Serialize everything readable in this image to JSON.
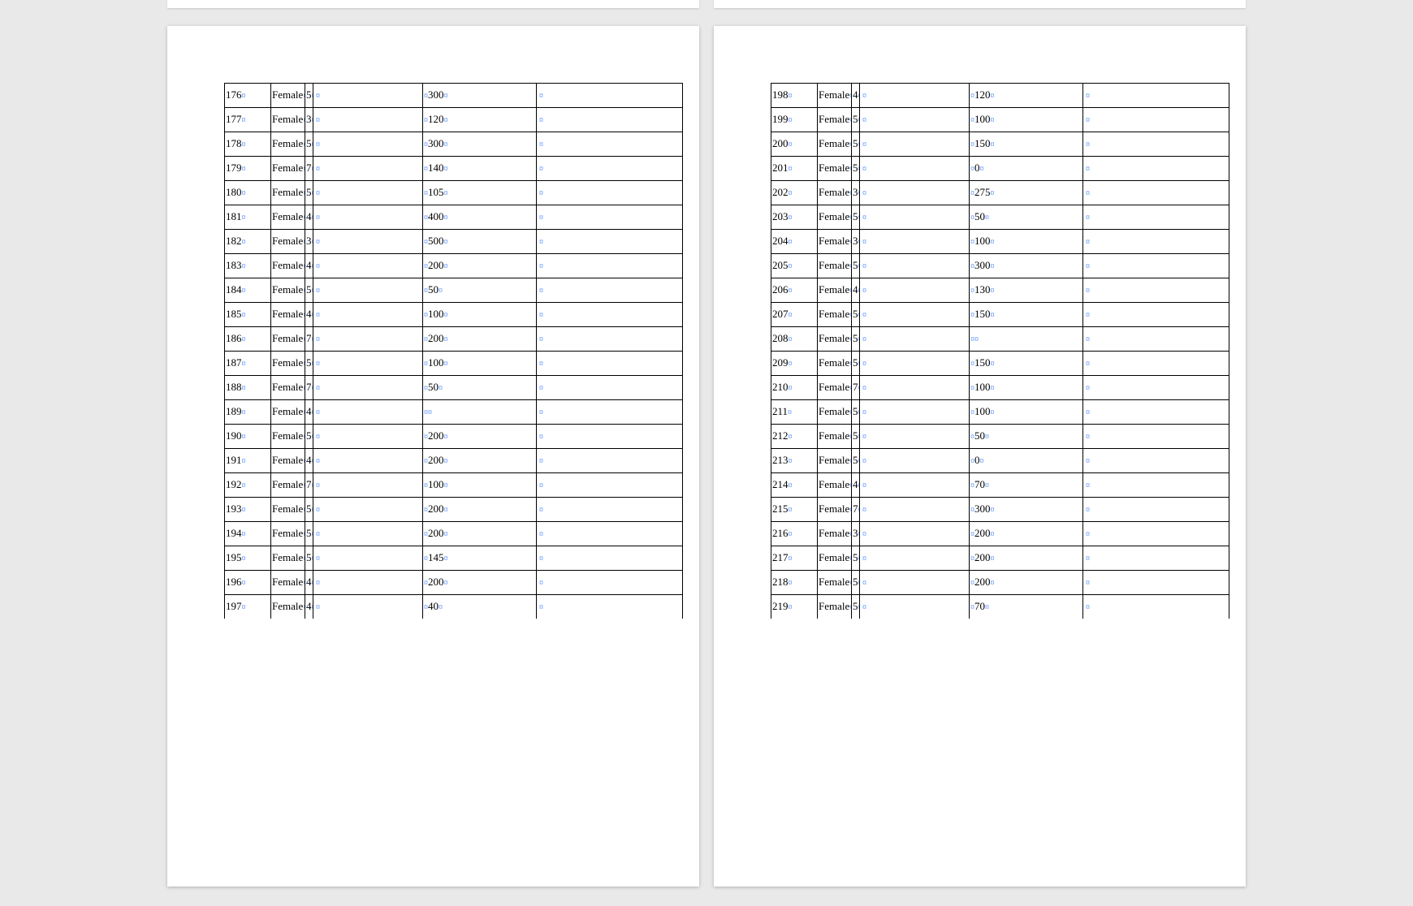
{
  "formatting_mark": "¤",
  "pages": [
    {
      "rows": [
        {
          "id": "176",
          "gender": "Female",
          "num": "5",
          "value": "300"
        },
        {
          "id": "177",
          "gender": "Female",
          "num": "3",
          "value": "120"
        },
        {
          "id": "178",
          "gender": "Female",
          "num": "5",
          "value": "300"
        },
        {
          "id": "179",
          "gender": "Female",
          "num": "7",
          "value": "140"
        },
        {
          "id": "180",
          "gender": "Female",
          "num": "5",
          "value": "105"
        },
        {
          "id": "181",
          "gender": "Female",
          "num": "4",
          "value": "400"
        },
        {
          "id": "182",
          "gender": "Female",
          "num": "3",
          "value": "500"
        },
        {
          "id": "183",
          "gender": "Female",
          "num": "4",
          "value": "200"
        },
        {
          "id": "184",
          "gender": "Female",
          "num": "5",
          "value": "50"
        },
        {
          "id": "185",
          "gender": "Female",
          "num": "4",
          "value": "100"
        },
        {
          "id": "186",
          "gender": "Female",
          "num": "7",
          "value": "200"
        },
        {
          "id": "187",
          "gender": "Female",
          "num": "5",
          "value": "100"
        },
        {
          "id": "188",
          "gender": "Female",
          "num": "7",
          "value": "50"
        },
        {
          "id": "189",
          "gender": "Female",
          "num": "4",
          "value": ""
        },
        {
          "id": "190",
          "gender": "Female",
          "num": "5",
          "value": "200"
        },
        {
          "id": "191",
          "gender": "Female",
          "num": "4",
          "value": "200"
        },
        {
          "id": "192",
          "gender": "Female",
          "num": "7",
          "value": "100"
        },
        {
          "id": "193",
          "gender": "Female",
          "num": "5",
          "value": "200"
        },
        {
          "id": "194",
          "gender": "Female",
          "num": "5",
          "value": "200"
        },
        {
          "id": "195",
          "gender": "Female",
          "num": "5",
          "value": "145"
        },
        {
          "id": "196",
          "gender": "Female",
          "num": "4",
          "value": "200"
        },
        {
          "id": "197",
          "gender": "Female",
          "num": "4",
          "value": "40"
        }
      ]
    },
    {
      "rows": [
        {
          "id": "198",
          "gender": "Female",
          "num": "4",
          "value": "120"
        },
        {
          "id": "199",
          "gender": "Female",
          "num": "5",
          "value": "100"
        },
        {
          "id": "200",
          "gender": "Female",
          "num": "5",
          "value": "150"
        },
        {
          "id": "201",
          "gender": "Female",
          "num": "5",
          "value": "0"
        },
        {
          "id": "202",
          "gender": "Female",
          "num": "3",
          "value": "275"
        },
        {
          "id": "203",
          "gender": "Female",
          "num": "5",
          "value": "50"
        },
        {
          "id": "204",
          "gender": "Female",
          "num": "3",
          "value": "100"
        },
        {
          "id": "205",
          "gender": "Female",
          "num": "5",
          "value": "300"
        },
        {
          "id": "206",
          "gender": "Female",
          "num": "4",
          "value": "130"
        },
        {
          "id": "207",
          "gender": "Female",
          "num": "5",
          "value": "150"
        },
        {
          "id": "208",
          "gender": "Female",
          "num": "5",
          "value": ""
        },
        {
          "id": "209",
          "gender": "Female",
          "num": "5",
          "value": "150"
        },
        {
          "id": "210",
          "gender": "Female",
          "num": "7",
          "value": "100"
        },
        {
          "id": "211",
          "gender": "Female",
          "num": "5",
          "value": "100"
        },
        {
          "id": "212",
          "gender": "Female",
          "num": "5",
          "value": "50"
        },
        {
          "id": "213",
          "gender": "Female",
          "num": "5",
          "value": "0"
        },
        {
          "id": "214",
          "gender": "Female",
          "num": "4",
          "value": "70"
        },
        {
          "id": "215",
          "gender": "Female",
          "num": "7",
          "value": "300"
        },
        {
          "id": "216",
          "gender": "Female",
          "num": "3",
          "value": "200"
        },
        {
          "id": "217",
          "gender": "Female",
          "num": "5",
          "value": "200"
        },
        {
          "id": "218",
          "gender": "Female",
          "num": "5",
          "value": "200"
        },
        {
          "id": "219",
          "gender": "Female",
          "num": "5",
          "value": "70"
        }
      ]
    }
  ]
}
